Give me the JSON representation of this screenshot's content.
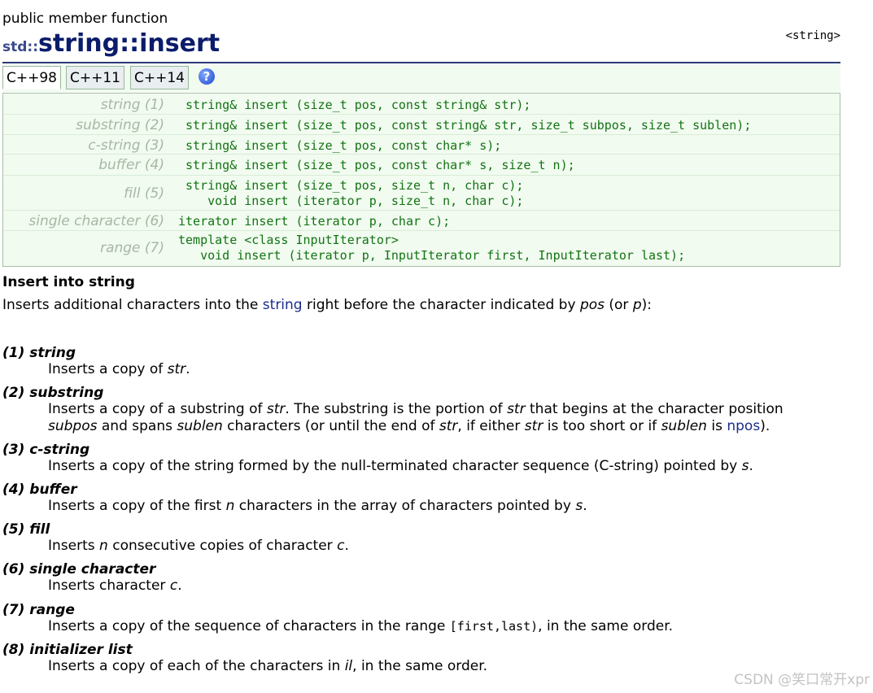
{
  "page": {
    "kind": "public member function",
    "title_ns": "std::",
    "title_class": "string",
    "title_sep": "::",
    "title_member": "insert",
    "header_ref": "<string>"
  },
  "tabs": [
    "C++98",
    "C++11",
    "C++14"
  ],
  "help_icon": "question-mark-icon",
  "declarations": [
    {
      "label": "string (1)",
      "code": "string& insert (size_t pos, const string& str);"
    },
    {
      "label": "substring (2)",
      "code": "string& insert (size_t pos, const string& str, size_t subpos, size_t sublen);"
    },
    {
      "label": "c-string (3)",
      "code": "string& insert (size_t pos, const char* s);"
    },
    {
      "label": "buffer (4)",
      "code": "string& insert (size_t pos, const char* s, size_t n);"
    },
    {
      "label": "fill (5)",
      "code": "string& insert (size_t pos, size_t n, char c);\n   void insert (iterator p, size_t n, char c);"
    },
    {
      "label": "single character (6)",
      "code": "iterator insert (iterator p, char c);"
    },
    {
      "label": "range (7)",
      "code": "template <class InputIterator>\n   void insert (iterator p, InputIterator first, InputIterator last);"
    }
  ],
  "section": {
    "title": "Insert into string",
    "intro_a": "Inserts additional characters into the ",
    "intro_link": "string",
    "intro_b": " right before the character indicated by ",
    "intro_pos": "pos",
    "intro_c": " (or ",
    "intro_p": "p",
    "intro_d": "):"
  },
  "items": {
    "t1": "(1) string",
    "d1": [
      "Inserts a copy of ",
      "str",
      "."
    ],
    "t2": "(2) substring",
    "d2a": [
      "Inserts a copy of a substring of ",
      "str",
      ". The substring is the portion of ",
      "str",
      " that begins at the character position"
    ],
    "d2b": [
      "subpos",
      " and spans ",
      "sublen",
      " characters (or until the end of ",
      "str",
      ", if either ",
      "str",
      " is too short or if ",
      "sublen",
      " is ",
      "npos",
      ")."
    ],
    "t3": "(3) c-string",
    "d3": [
      "Inserts a copy of the string formed by the null-terminated character sequence (C-string) pointed by ",
      "s",
      "."
    ],
    "t4": "(4) buffer",
    "d4": [
      "Inserts a copy of the first ",
      "n",
      " characters in the array of characters pointed by ",
      "s",
      "."
    ],
    "t5": "(5) fill",
    "d5": [
      "Inserts ",
      "n",
      " consecutive copies of character ",
      "c",
      "."
    ],
    "t6": "(6) single character",
    "d6": [
      "Inserts character ",
      "c",
      "."
    ],
    "t7": "(7) range",
    "d7": [
      "Inserts a copy of the sequence of characters in the range ",
      "[first,last)",
      ", in the same order."
    ],
    "t8": "(8) initializer list",
    "d8": [
      "Inserts a copy of each of the characters in ",
      "il",
      ", in the same order."
    ]
  },
  "watermark": "CSDN @笑口常开xpr"
}
